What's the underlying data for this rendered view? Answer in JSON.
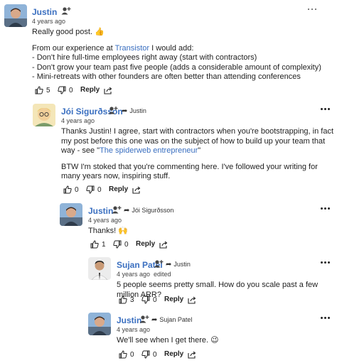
{
  "comments": [
    {
      "author": "Justin",
      "time": "4 years ago",
      "lines": [
        "Really good post. 👍"
      ],
      "paragraph2": {
        "prefix": "From our experience at ",
        "link": "Transistor",
        "suffix": " I would add:"
      },
      "bullets": [
        "- Don't hire full-time employees right away (start with contractors)",
        "- Don't grow your team past five people (adds a considerable amount of complexity)",
        "- Mini-retreats with other founders are often better than attending conferences"
      ],
      "upvotes": "5",
      "downvotes": "0",
      "reply_label": "Reply"
    },
    {
      "author": "Jói Sigurðsson",
      "reply_to": "Justin",
      "time": "4 years ago",
      "p1_prefix": "Thanks Justin! I agree, start with contractors when you're bootstrapping, in fact my post before this one was on the subject of how to build up your team that way - see \"",
      "p1_link": "The spiderweb entrepreneur",
      "p1_suffix": "\"",
      "p2": "BTW I'm stoked that you're commenting here. I've followed your writing for many years now, inspiring stuff.",
      "upvotes": "0",
      "downvotes": "0",
      "reply_label": "Reply"
    },
    {
      "author": "Justin",
      "reply_to": "Jói Sigurðsson",
      "time": "4 years ago",
      "text": "Thanks! 🙌",
      "upvotes": "1",
      "downvotes": "0",
      "reply_label": "Reply"
    },
    {
      "author": "Sujan Patel",
      "reply_to": "Justin",
      "time": "4 years ago",
      "edited": "edited",
      "text": "5 people seems pretty small. How do you scale past a few million ARR?",
      "upvotes": "3",
      "downvotes": "0",
      "reply_label": "Reply"
    },
    {
      "author": "Justin",
      "reply_to": "Sujan Patel",
      "time": "4 years ago",
      "text": "We'll see when I get there. 😉",
      "upvotes": "0",
      "downvotes": "0",
      "reply_label": "Reply"
    }
  ],
  "icons": {
    "upvote": "thumbs-up-icon",
    "downvote": "thumbs-down-icon",
    "share": "share-icon",
    "follow": "follow-user-icon",
    "menu": "more-options-icon",
    "reply_arrow": "reply-arrow-icon"
  },
  "colors": {
    "author": "#3a6fc0",
    "link": "#3a6fc0",
    "text": "#1f1f1f"
  }
}
